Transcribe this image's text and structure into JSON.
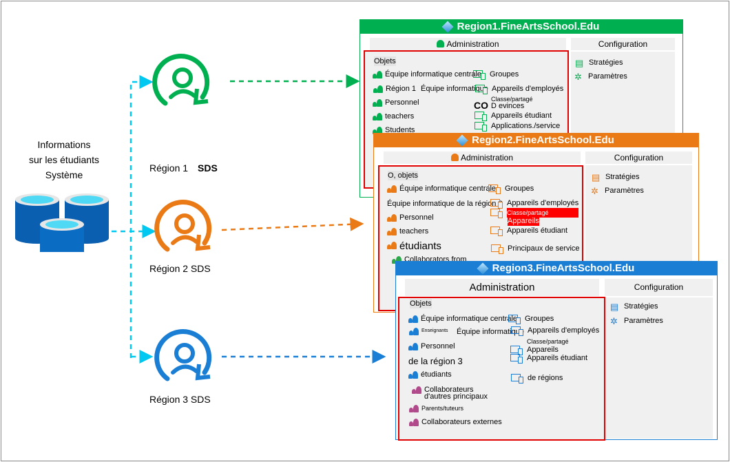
{
  "source": {
    "lines": [
      "Informations",
      "sur les étudiants",
      "Système"
    ],
    "icon": "database-icon"
  },
  "sds": [
    {
      "label": "Région 1",
      "bold": "SDS",
      "color": "#00b050",
      "icon": "sync-user-icon"
    },
    {
      "label": "Région 2 SDS",
      "color": "#e97a16",
      "icon": "sync-user-icon"
    },
    {
      "label": "Région 3 SDS",
      "color": "#1a7fd4",
      "icon": "sync-user-icon"
    }
  ],
  "connector_color": "#00c8f0",
  "regions": [
    {
      "title": "Region1.FineArtsSchool.Edu",
      "color": "#00b050",
      "admin": "Administration",
      "config": "Configuration",
      "objects_label": "Objets",
      "left_items": [
        "Équipe informatique centrale",
        "Région 1",
        "Équipe informatique",
        "Personnel",
        "teachers",
        "Students"
      ],
      "right_items": [
        "Groupes",
        "Appareils d'employés",
        "Classe/partagé",
        "CO",
        "D evinces",
        "Appareils étudiant",
        "Applications./service"
      ],
      "config_items": [
        "Stratégies",
        "Paramètres"
      ]
    },
    {
      "title": "Region2.FineArtsSchool.Edu",
      "color": "#e97a16",
      "admin": "Administration",
      "config": "Configuration",
      "objects_label": "O, objets",
      "left_items": [
        "Équipe informatique centrale",
        "Équipe informatique de la région 2",
        "Personnel",
        "teachers",
        "étudiants",
        "Collaborators from"
      ],
      "right_items": [
        "Groupes",
        "Appareils d'employés",
        "Classe/partagé",
        "Appareils",
        "Appareils étudiant",
        "Principaux de service"
      ],
      "config_items": [
        "Stratégies",
        "Paramètres"
      ]
    },
    {
      "title": "Region3.FineArtsSchool.Edu",
      "color": "#1a7fd4",
      "admin": "Administration",
      "config": "Configuration",
      "objects_label": "Objets",
      "left_items": [
        "Équipe informatique centrale",
        "Enseignants",
        "Équipe informatique",
        "Personnel",
        "de la région 3",
        "étudiants",
        "Collaborateurs",
        "d'autres principaux",
        "Parents/tuteurs",
        "Collaborateurs externes"
      ],
      "right_items": [
        "Groupes",
        "Appareils d'employés",
        "Classe/partagé",
        "Appareils",
        "Appareils étudiant",
        "de régions"
      ],
      "config_items": [
        "Stratégies",
        "Paramètres"
      ]
    }
  ]
}
